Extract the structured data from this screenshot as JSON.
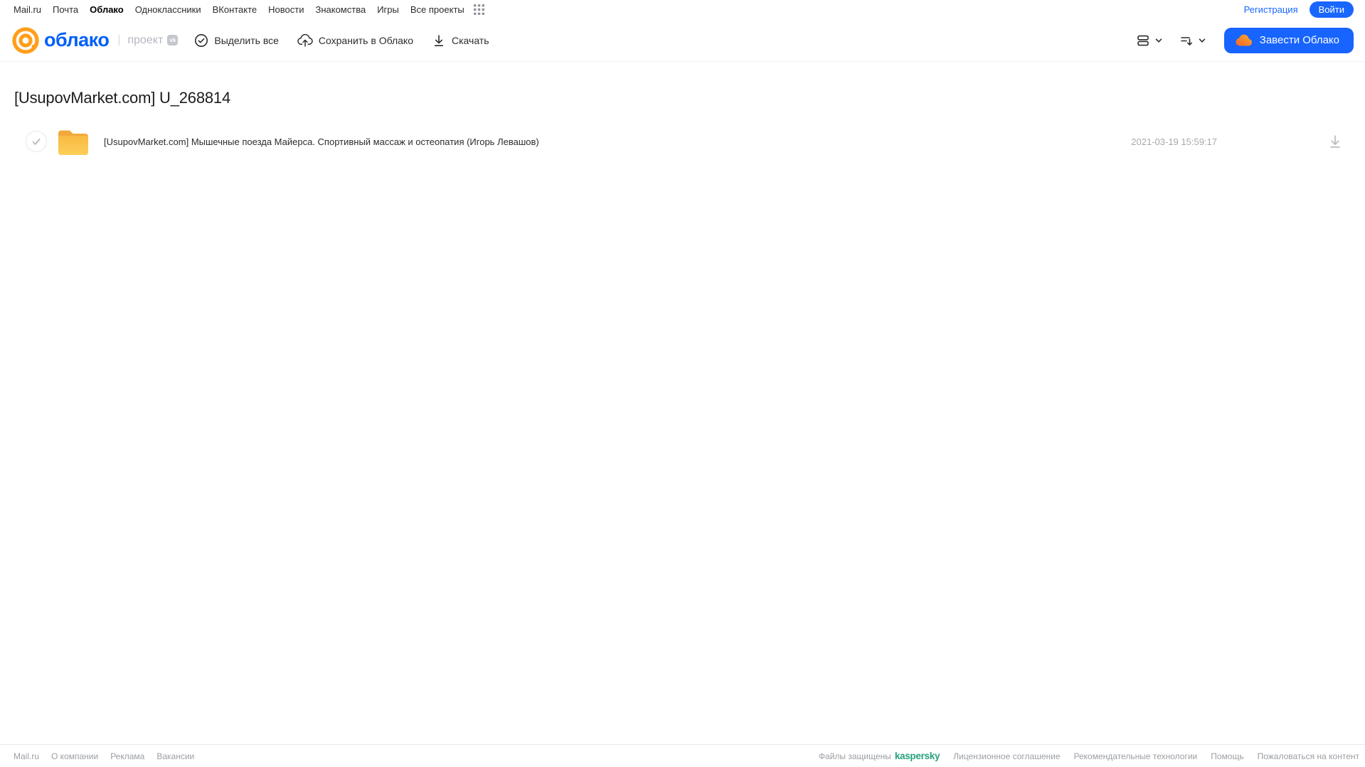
{
  "top_nav": {
    "items": [
      "Mail.ru",
      "Почта",
      "Облако",
      "Одноклассники",
      "ВКонтакте",
      "Новости",
      "Знакомства",
      "Игры",
      "Все проекты"
    ],
    "active_item": "Облако",
    "registration_label": "Регистрация",
    "login_label": "Войти"
  },
  "header": {
    "logo_text": "облако",
    "project_label": "проект",
    "vk_badge": "vk",
    "toolbar": {
      "select_all_label": "Выделить все",
      "save_to_cloud_label": "Сохранить в Облако",
      "download_label": "Скачать"
    },
    "create_cloud_label": "Завести Облако"
  },
  "content": {
    "page_title": "[UsupovMarket.com] U_268814",
    "files": [
      {
        "type": "folder",
        "name": "[UsupovMarket.com] Мышечные поезда Майерса. Спортивный массаж и остеопатия (Игорь Левашов)",
        "modified": "2021-03-19 15:59:17"
      }
    ]
  },
  "footer": {
    "left_links": [
      "Mail.ru",
      "О компании",
      "Реклама",
      "Вакансии"
    ],
    "protected_by_label": "Файлы защищены",
    "kaspersky_label": "kaspersky",
    "right_links": [
      "Лицензионное соглашение",
      "Рекомендательные технологии",
      "Помощь",
      "Пожаловаться на контент"
    ]
  },
  "colors": {
    "accent_blue": "#1966ff",
    "logo_blue": "#005ff9",
    "logo_orange": "#ff9e19",
    "folder_yellow": "#fbc445",
    "kaspersky_green": "#26a17c",
    "muted_gray": "#a0a3a8"
  }
}
